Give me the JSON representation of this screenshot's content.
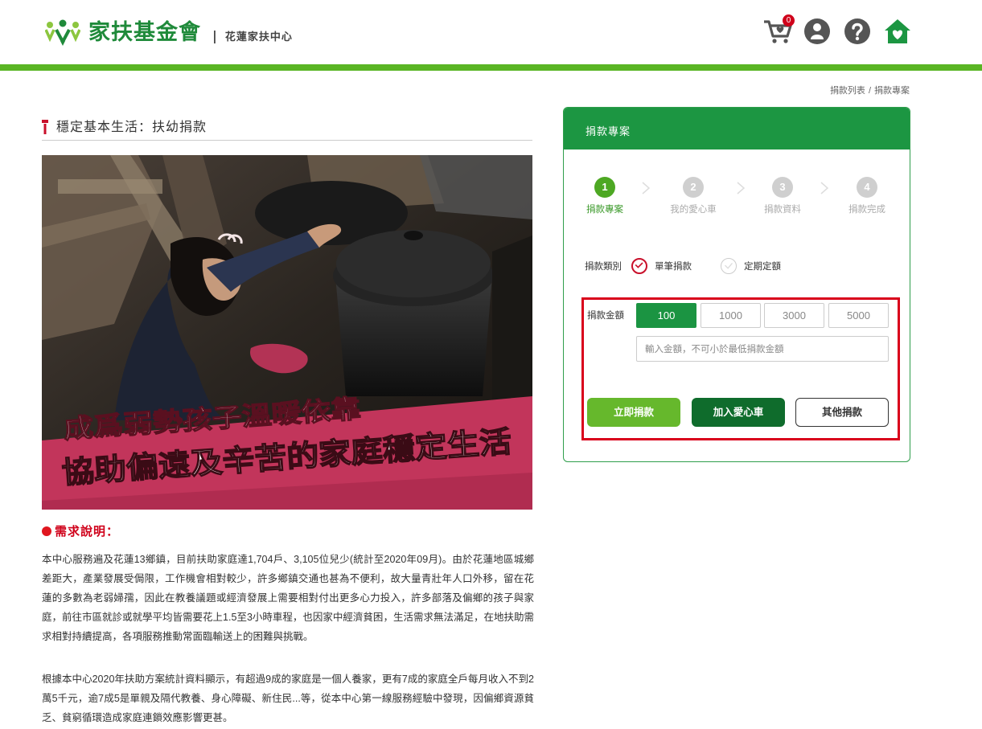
{
  "header": {
    "logo_name": "家扶基金會",
    "logo_sep": "|",
    "logo_sub": "花蓮家扶中心",
    "cart_count": "0",
    "icons": [
      "cart-heart-icon",
      "user-icon",
      "help-icon",
      "home-heart-icon"
    ]
  },
  "breadcrumb": [
    "捐款列表",
    "/",
    "捐款專案"
  ],
  "page": {
    "title": "穩定基本生活：扶幼捐款",
    "banner_line1": "成爲弱勢孩子溫暖依靠",
    "banner_line2": "協助偏遠及辛苦的家庭穩定生活",
    "need_heading": "需求說明：",
    "paragraph1": "本中心服務遍及花蓮13鄉鎮，目前扶助家庭達1,704戶、3,105位兒少(統計至2020年09月)。由於花蓮地區城鄉差距大，產業發展受侷限，工作機會相對較少，許多鄉鎮交通也甚為不便利，故大量青壯年人口外移，留在花蓮的多數為老弱婦孺，因此在教養議題或經濟發展上需要相對付出更多心力投入，許多部落及偏鄉的孩子與家庭，前往市區就診或就學平均皆需要花上1.5至3小時車程，也因家中經濟貧困，生活需求無法滿足，在地扶助需求相對持續提高，各項服務推動常面臨輸送上的困難與挑戰。",
    "paragraph2": "根據本中心2020年扶助方案統計資料顯示，有超過9成的家庭是一個人養家，更有7成的家庭全戶每月收入不到2萬5千元，逾7成5是單親及隔代教養、身心障礙、新住民...等，從本中心第一線服務經驗中發現，因偏鄉資源貧乏、貧窮循環造成家庭連鎖效應影響更甚。"
  },
  "donate": {
    "card_title": "捐款專案",
    "steps": [
      {
        "num": "1",
        "label": "捐款專案",
        "state": "active"
      },
      {
        "num": "2",
        "label": "我的愛心車",
        "state": "inactive"
      },
      {
        "num": "3",
        "label": "捐款資料",
        "state": "inactive"
      },
      {
        "num": "4",
        "label": "捐款完成",
        "state": "inactive"
      }
    ],
    "type_label": "捐款類別",
    "type_options": [
      {
        "label": "單筆捐款",
        "selected": true
      },
      {
        "label": "定期定額",
        "selected": false
      }
    ],
    "amount_label": "捐款金額",
    "amounts": [
      "100",
      "1000",
      "3000",
      "5000"
    ],
    "selected_amount": "100",
    "amount_placeholder": "輸入金額，不可小於最低捐款金額",
    "buttons": {
      "donate_now": "立即捐款",
      "add_to_cart": "加入愛心車",
      "other": "其他捐款"
    }
  },
  "colors": {
    "brand_green": "#1c9642",
    "bar_green": "#5ab524",
    "highlight_red": "#d9001b",
    "need_red": "#d0021b"
  }
}
